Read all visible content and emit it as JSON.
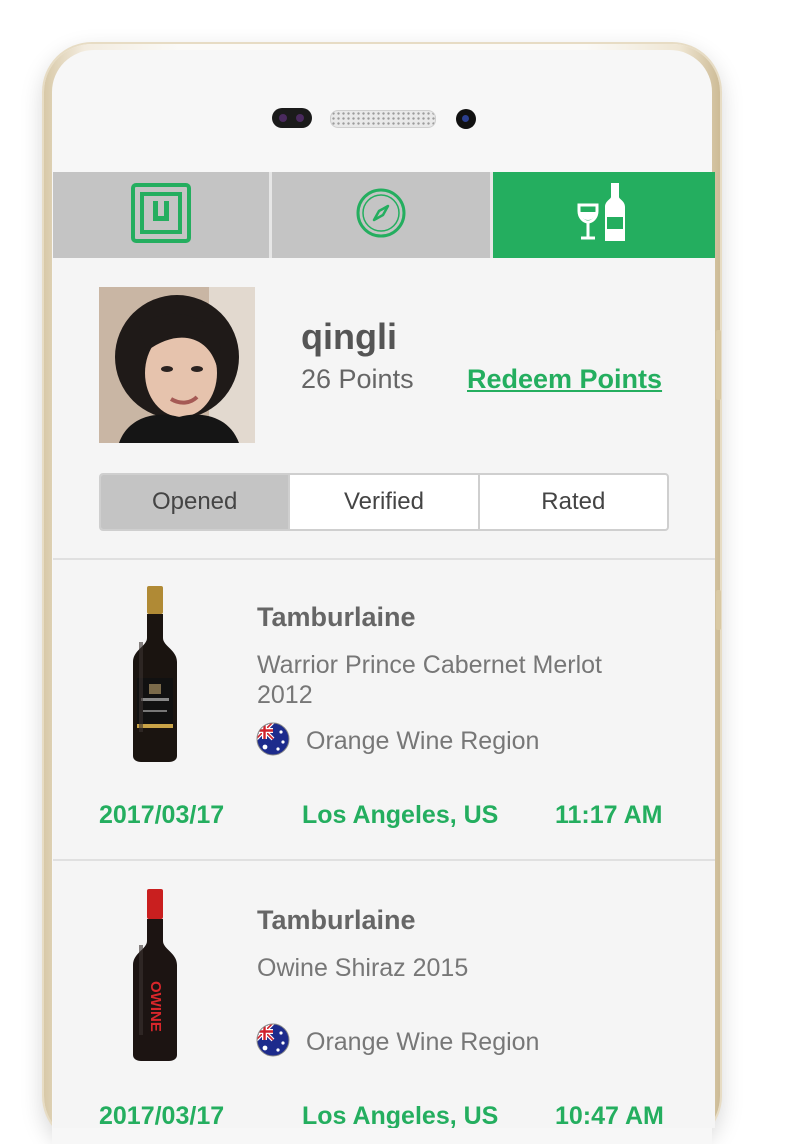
{
  "tabs": [
    {
      "icon": "nfc-scan-icon",
      "active": false
    },
    {
      "icon": "compass-icon",
      "active": false
    },
    {
      "icon": "wine-glass-bottle-icon",
      "active": true
    }
  ],
  "colors": {
    "accent": "#24ae5f",
    "tab_inactive": "#c4c4c4"
  },
  "profile": {
    "username": "qingli",
    "points": "26 Points",
    "redeem_label": "Redeem Points"
  },
  "segments": [
    {
      "label": "Opened",
      "active": true
    },
    {
      "label": "Verified",
      "active": false
    },
    {
      "label": "Rated",
      "active": false
    }
  ],
  "wines": [
    {
      "producer": "Tamburlaine",
      "name_line1": "Warrior Prince Cabernet Merlot",
      "name_line2": "2012",
      "region": "Orange Wine Region",
      "flag": "australia-flag-icon",
      "date": "2017/03/17",
      "location": "Los Angeles, US",
      "time": "11:17 AM"
    },
    {
      "producer": "Tamburlaine",
      "name_line1": "Owine Shiraz 2015",
      "name_line2": "",
      "region": "Orange Wine Region",
      "flag": "australia-flag-icon",
      "date": "2017/03/17",
      "location": "Los Angeles, US",
      "time": "10:47 AM"
    }
  ]
}
